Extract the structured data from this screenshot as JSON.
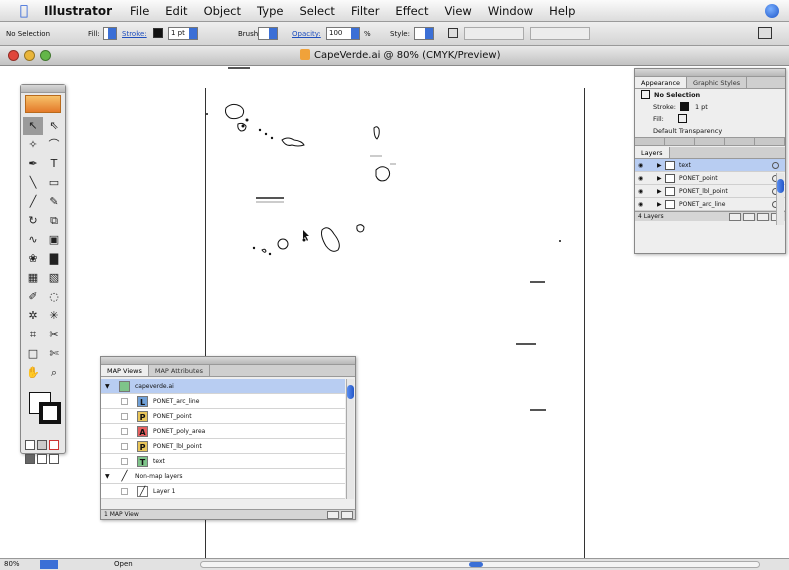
{
  "menubar": {
    "app_name": "Illustrator",
    "items": [
      "File",
      "Edit",
      "Object",
      "Type",
      "Select",
      "Filter",
      "Effect",
      "View",
      "Window",
      "Help"
    ]
  },
  "control_bar": {
    "selection": "No Selection",
    "fill_label": "Fill:",
    "stroke_label": "Stroke:",
    "stroke_weight": "1 pt",
    "brush_label": "Brush:",
    "opacity_label": "Opacity:",
    "opacity_value": "100",
    "style_label": "Style:",
    "percent": "%"
  },
  "document": {
    "title": "CapeVerde.ai @ 80% (CMYK/Preview)"
  },
  "appearance_panel": {
    "tabs": [
      "Appearance",
      "Graphic Styles"
    ],
    "selection_label": "No Selection",
    "stroke_label": "Stroke:",
    "stroke_value": "1 pt",
    "fill_label": "Fill:",
    "transparency_label": "Default Transparency"
  },
  "layers_panel": {
    "tab": "Layers",
    "layers": [
      {
        "name": "text",
        "selected": true
      },
      {
        "name": "PONET_point"
      },
      {
        "name": "PONET_lbl_point"
      },
      {
        "name": "PONET_arc_line"
      }
    ],
    "footer": "4 Layers"
  },
  "map_views_panel": {
    "tabs": [
      "MAP Views",
      "MAP Attributes"
    ],
    "rows": [
      {
        "name": "capeverde.ai",
        "level": 0,
        "selected": true,
        "badge": ""
      },
      {
        "name": "PONET_arc_line",
        "level": 1,
        "badge": "L",
        "badge_color": "#6fa0d8"
      },
      {
        "name": "PONET_point",
        "level": 1,
        "badge": "P",
        "badge_color": "#e9c65a"
      },
      {
        "name": "PONET_poly_area",
        "level": 1,
        "badge": "A",
        "badge_color": "#e66060"
      },
      {
        "name": "PONET_lbl_point",
        "level": 1,
        "badge": "P",
        "badge_color": "#e9c65a"
      },
      {
        "name": "text",
        "level": 1,
        "badge": "T",
        "badge_color": "#7ec48a"
      },
      {
        "name": "Non-map layers",
        "level": 0,
        "badge": ""
      },
      {
        "name": "Layer 1",
        "level": 1,
        "badge": ""
      }
    ],
    "footer": "1 MAP View"
  },
  "status_bar": {
    "zoom": "80%",
    "mode": "Open"
  }
}
